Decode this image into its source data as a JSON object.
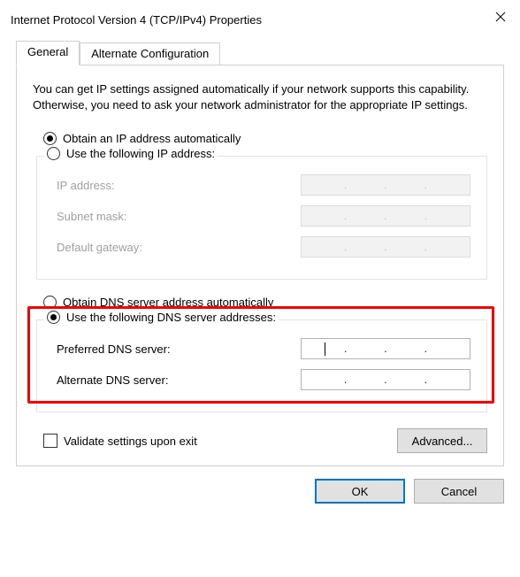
{
  "window": {
    "title": "Internet Protocol Version 4 (TCP/IPv4) Properties"
  },
  "tabs": {
    "general": "General",
    "alternate": "Alternate Configuration"
  },
  "intro": "You can get IP settings assigned automatically if your network supports this capability. Otherwise, you need to ask your network administrator for the appropriate IP settings.",
  "ip": {
    "auto_label": "Obtain an IP address automatically",
    "manual_label": "Use the following IP address:",
    "fields": {
      "address": "IP address:",
      "subnet": "Subnet mask:",
      "gateway": "Default gateway:"
    },
    "values": {
      "address": [
        "",
        "",
        "",
        ""
      ],
      "subnet": [
        "",
        "",
        "",
        ""
      ],
      "gateway": [
        "",
        "",
        "",
        ""
      ]
    },
    "selected": "auto"
  },
  "dns": {
    "auto_label": "Obtain DNS server address automatically",
    "manual_label": "Use the following DNS server addresses:",
    "fields": {
      "preferred": "Preferred DNS server:",
      "alternate": "Alternate DNS server:"
    },
    "values": {
      "preferred": [
        "",
        "",
        "",
        ""
      ],
      "alternate": [
        "",
        "",
        "",
        ""
      ]
    },
    "selected": "manual"
  },
  "validate_label": "Validate settings upon exit",
  "validate_checked": false,
  "buttons": {
    "advanced": "Advanced...",
    "ok": "OK",
    "cancel": "Cancel"
  }
}
